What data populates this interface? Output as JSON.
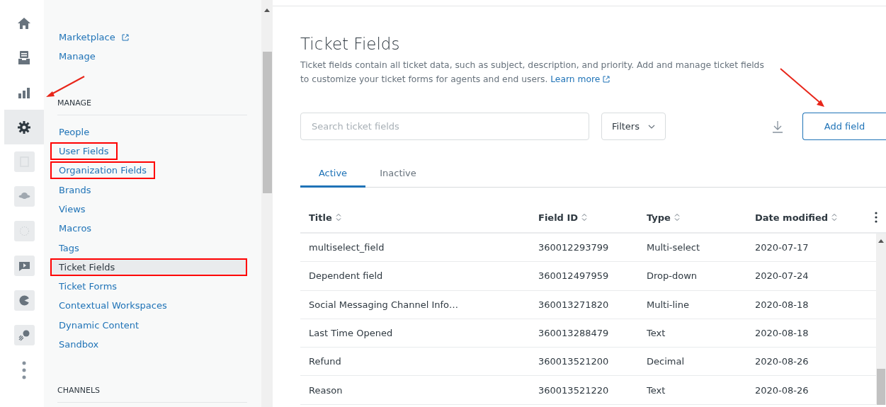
{
  "rail": [
    {
      "kind": "home",
      "selected": false
    },
    {
      "kind": "inbox",
      "selected": false
    },
    {
      "kind": "chart",
      "selected": false
    },
    {
      "kind": "gear",
      "selected": true
    },
    {
      "kind": "tile-doc",
      "selected": false
    },
    {
      "kind": "tile-planet",
      "selected": false
    },
    {
      "kind": "tile-dots",
      "selected": false
    },
    {
      "kind": "tile-chat",
      "selected": false
    },
    {
      "kind": "tile-pie",
      "selected": false
    },
    {
      "kind": "tile-comet",
      "selected": false
    },
    {
      "kind": "more",
      "selected": false
    }
  ],
  "sidebar": {
    "sections": [
      {
        "items": [
          {
            "label": "Marketplace",
            "external": true,
            "selected": false,
            "highlighted": false
          },
          {
            "label": "Manage",
            "external": false,
            "selected": false,
            "highlighted": false
          }
        ]
      },
      {
        "heading": "MANAGE",
        "items": [
          {
            "label": "People",
            "external": false,
            "selected": false,
            "highlighted": false
          },
          {
            "label": "User Fields",
            "external": false,
            "selected": false,
            "highlighted": true
          },
          {
            "label": "Organization Fields",
            "external": false,
            "selected": false,
            "highlighted": true
          },
          {
            "label": "Brands",
            "external": false,
            "selected": false,
            "highlighted": false
          },
          {
            "label": "Views",
            "external": false,
            "selected": false,
            "highlighted": false
          },
          {
            "label": "Macros",
            "external": false,
            "selected": false,
            "highlighted": false
          },
          {
            "label": "Tags",
            "external": false,
            "selected": false,
            "highlighted": false
          },
          {
            "label": "Ticket Fields",
            "external": false,
            "selected": true,
            "highlighted": true
          },
          {
            "label": "Ticket Forms",
            "external": false,
            "selected": false,
            "highlighted": false
          },
          {
            "label": "Contextual Workspaces",
            "external": false,
            "selected": false,
            "highlighted": false
          },
          {
            "label": "Dynamic Content",
            "external": false,
            "selected": false,
            "highlighted": false
          },
          {
            "label": "Sandbox",
            "external": false,
            "selected": false,
            "highlighted": false
          }
        ]
      },
      {
        "heading": "CHANNELS"
      }
    ]
  },
  "page": {
    "title": "Ticket Fields",
    "description": "Ticket fields contain all ticket data, such as subject, description, and priority. Add and manage ticket fields to customize your ticket forms for agents and end users.",
    "learn_more": "Learn more"
  },
  "search": {
    "placeholder": "Search ticket fields"
  },
  "filters": {
    "label": "Filters"
  },
  "add_button": {
    "label": "Add field"
  },
  "tabs": [
    {
      "label": "Active",
      "selected": true
    },
    {
      "label": "Inactive",
      "selected": false
    }
  ],
  "table": {
    "columns": [
      "Title",
      "Field ID",
      "Type",
      "Date modified"
    ],
    "rows": [
      [
        "multiselect_field",
        "360012293799",
        "Multi-select",
        "2020-07-17"
      ],
      [
        "Dependent field",
        "360012497959",
        "Drop-down",
        "2020-07-24"
      ],
      [
        "Social Messaging Channel Info…",
        "360013271820",
        "Multi-line",
        "2020-08-18"
      ],
      [
        "Last Time Opened",
        "360013288479",
        "Text",
        "2020-08-18"
      ],
      [
        "Refund",
        "360013521200",
        "Decimal",
        "2020-08-26"
      ],
      [
        "Reason",
        "360013521220",
        "Text",
        "2020-08-26"
      ]
    ]
  }
}
